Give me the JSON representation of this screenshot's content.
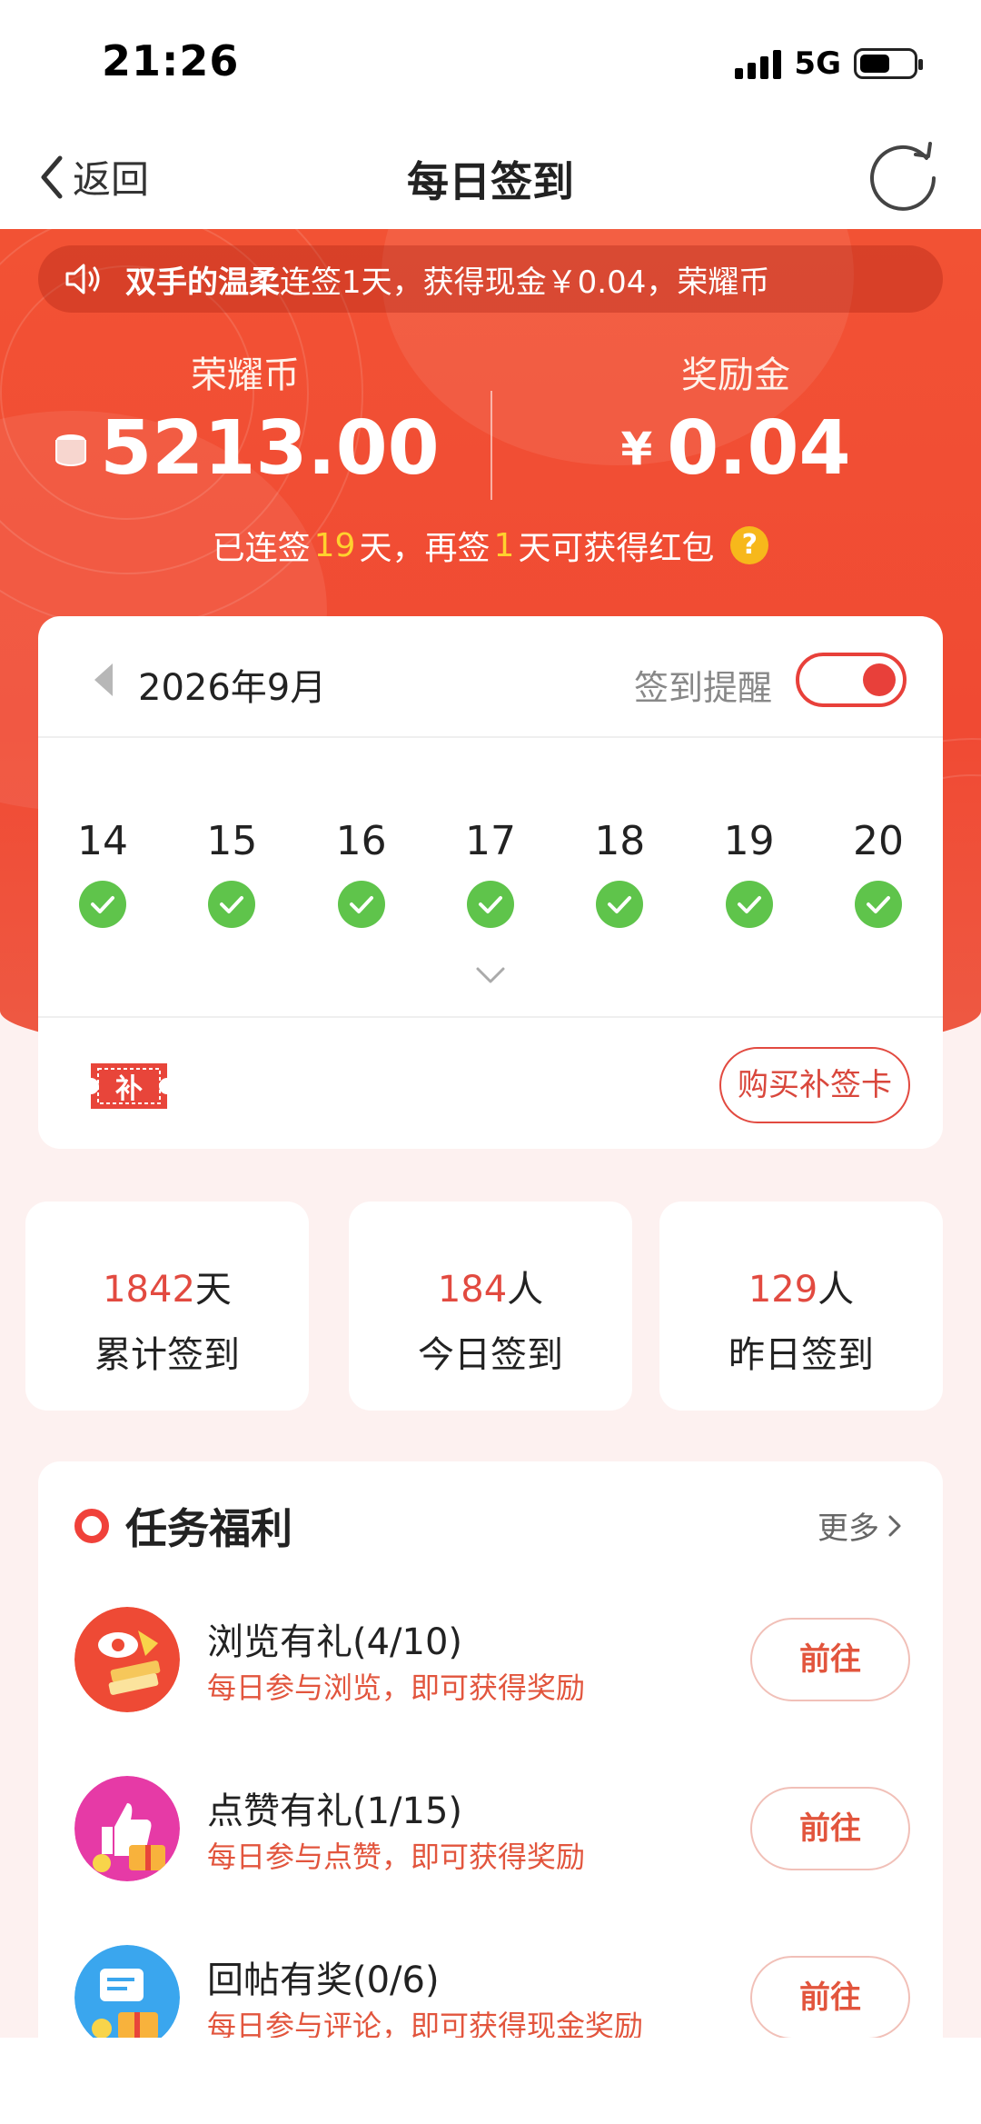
{
  "status_bar": {
    "time": "21:26",
    "network": "5G"
  },
  "nav": {
    "back_label": "返回",
    "title": "每日签到"
  },
  "announcement": {
    "user": "双手的温柔",
    "text": "连签1天，获得现金￥0.04，荣耀币"
  },
  "wallet": {
    "coins_label": "荣耀币",
    "coins_value": "5213.00",
    "bonus_label": "奖励金",
    "bonus_symbol": "¥",
    "bonus_value": "0.04"
  },
  "streak": {
    "pre": "已连签",
    "days": "19",
    "mid": "天，再签",
    "remain": "1",
    "post": "天可获得红包",
    "help": "?"
  },
  "calendar": {
    "month": "2026年9月",
    "remind_label": "签到提醒",
    "remind_on": true,
    "days": [
      "14",
      "15",
      "16",
      "17",
      "18",
      "19",
      "20"
    ],
    "checked": [
      true,
      true,
      true,
      true,
      true,
      true,
      true
    ],
    "makeup_icon_text": "补",
    "buy_label": "购买补签卡"
  },
  "stats": [
    {
      "value": "1842",
      "unit": "天",
      "label": "累计签到"
    },
    {
      "value": "184",
      "unit": "人",
      "label": "今日签到"
    },
    {
      "value": "129",
      "unit": "人",
      "label": "昨日签到"
    }
  ],
  "tasks": {
    "title": "任务福利",
    "more": "更多",
    "go_label": "前往",
    "items": [
      {
        "name": "浏览有礼(4/10)",
        "desc": "每日参与浏览，即可获得奖励",
        "icon": "browse-gift-icon"
      },
      {
        "name": "点赞有礼(1/15)",
        "desc": "每日参与点赞，即可获得奖励",
        "icon": "like-gift-icon"
      },
      {
        "name": "回帖有奖(0/6)",
        "desc": "每日参与评论，即可获得现金奖励",
        "icon": "reply-gift-icon"
      }
    ]
  },
  "colors": {
    "brand": "#f04a33",
    "accent_text": "#e24a40",
    "check": "#5fc44b",
    "highlight": "#ffd22e"
  }
}
